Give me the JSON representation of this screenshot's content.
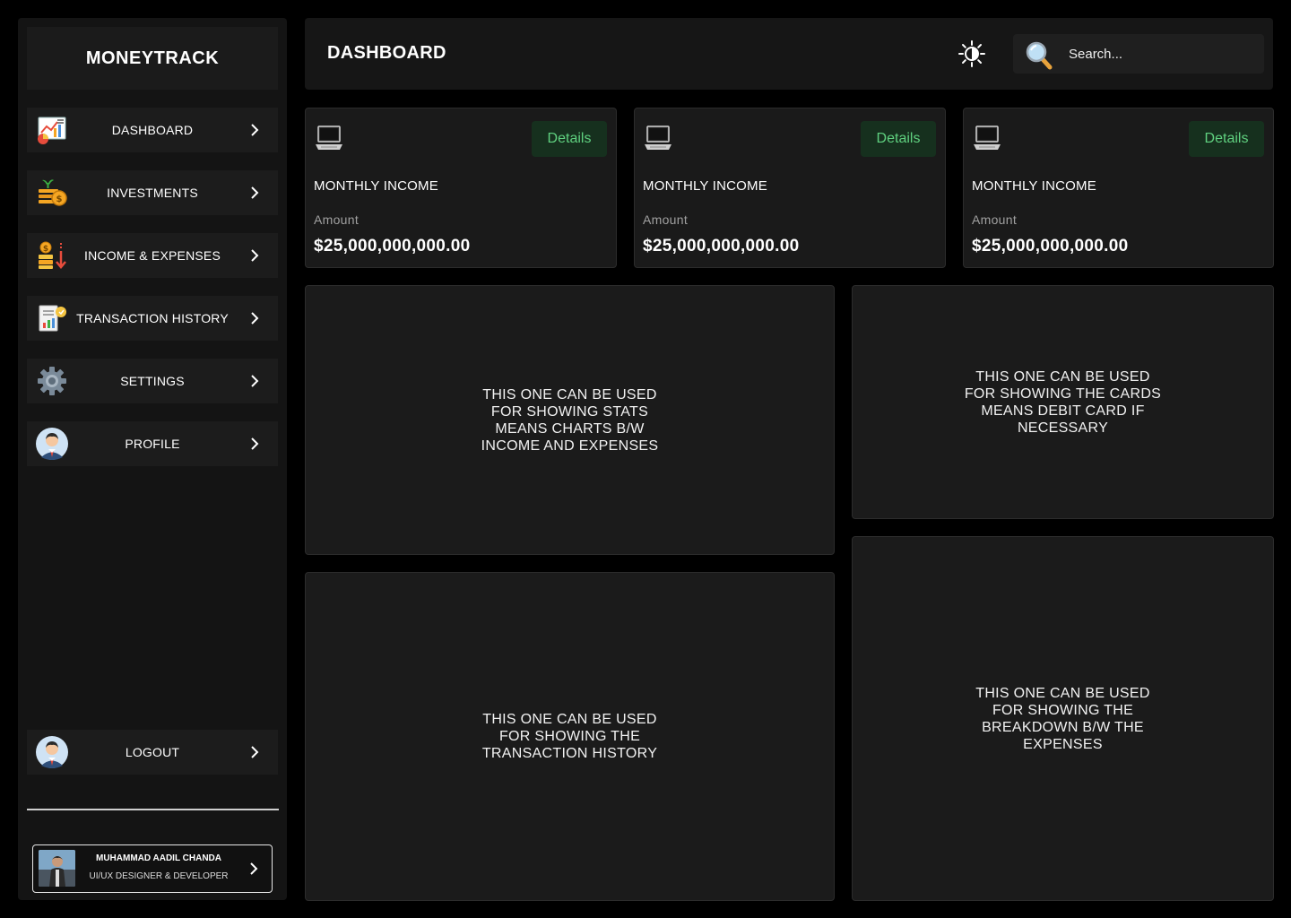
{
  "app": {
    "brand": "MONEYTRACK"
  },
  "sidebar": {
    "items": [
      {
        "label": "DASHBOARD",
        "icon": "dashboard-chart-icon"
      },
      {
        "label": "INVESTMENTS",
        "icon": "investment-coins-icon"
      },
      {
        "label": "INCOME & EXPENSES",
        "icon": "income-expense-icon"
      },
      {
        "label": "TRANSACTION HISTORY",
        "icon": "transaction-history-icon"
      },
      {
        "label": "SETTINGS",
        "icon": "gear-icon"
      },
      {
        "label": "PROFILE",
        "icon": "avatar-icon"
      }
    ],
    "logout": {
      "label": "LOGOUT",
      "icon": "avatar-icon"
    },
    "user": {
      "name": "MUHAMMAD AADIL CHANDA",
      "role": "UI/UX DESIGNER & DEVELOPER"
    }
  },
  "header": {
    "title": "DASHBOARD",
    "theme_icon": "brightness-icon",
    "search": {
      "placeholder": "Search...",
      "value": "",
      "icon": "search-icon"
    }
  },
  "stat_cards": [
    {
      "title": "MONTHLY INCOME",
      "amount_label": "Amount",
      "amount": "$25,000,000,000.00",
      "button": "Details",
      "icon": "laptop-icon"
    },
    {
      "title": "MONTHLY INCOME",
      "amount_label": "Amount",
      "amount": "$25,000,000,000.00",
      "button": "Details",
      "icon": "laptop-icon"
    },
    {
      "title": "MONTHLY INCOME",
      "amount_label": "Amount",
      "amount": "$25,000,000,000.00",
      "button": "Details",
      "icon": "laptop-icon"
    }
  ],
  "panels": {
    "stats": "THIS ONE CAN BE USED FOR SHOWING STATS MEANS CHARTS B/W INCOME AND EXPENSES",
    "cards": "THIS ONE CAN BE USED FOR SHOWING THE CARDS MEANS DEBIT CARD IF NECESSARY",
    "history": "THIS ONE CAN BE USED FOR SHOWING THE TRANSACTION HISTORY",
    "breakdown": "THIS ONE CAN BE USED FOR SHOWING THE BREAKDOWN B/W THE EXPENSES"
  },
  "colors": {
    "background": "#000000",
    "sidebar": "#141414",
    "card": "#1a1a1a",
    "accent_green": "#5fd07f",
    "button_bg": "#16301e"
  }
}
